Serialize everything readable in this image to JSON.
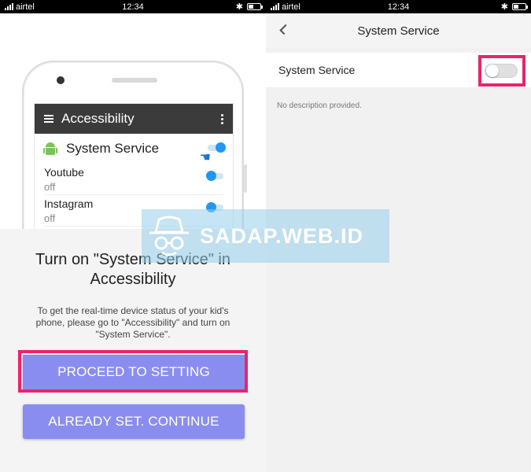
{
  "status_left": {
    "carrier": "airtel",
    "time": "12:34"
  },
  "status_right": {
    "carrier": "airtel",
    "time": "12:34"
  },
  "phone_mock": {
    "header_title": "Accessibility",
    "main_service": "System Service",
    "apps": [
      {
        "name": "Youtube",
        "state": "off"
      },
      {
        "name": "Instagram",
        "state": "off"
      }
    ]
  },
  "dialog": {
    "title": "Turn on \"System Service\" in Accessibility",
    "description": "To get the real-time device status of your kid's phone, please go to \"Accessibility\" and turn on \"System Service\".",
    "proceed_label": "PROCEED TO SETTING",
    "continue_label": "ALREADY SET. CONTINUE"
  },
  "settings": {
    "title": "System Service",
    "row_label": "System Service",
    "toggle_on": false,
    "description": "No description provided."
  },
  "watermark": {
    "text": "SADAP.WEB.ID"
  },
  "colors": {
    "button": "#8a8df0",
    "highlight": "#e8256a",
    "toggle_blue": "#2196f3",
    "android_green": "#78c257"
  }
}
